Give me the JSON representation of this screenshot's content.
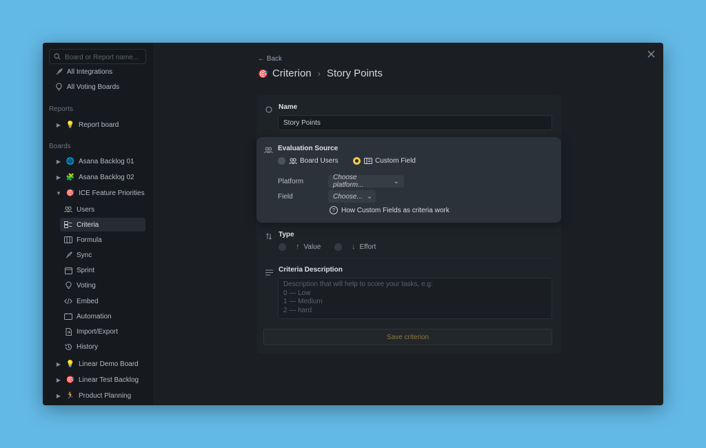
{
  "sidebar": {
    "search_placeholder": "Board or Report name...",
    "top_items": [
      {
        "label": "All Integrations",
        "icon": "rocket-icon"
      },
      {
        "label": "All Voting Boards",
        "icon": "lightbulb-icon"
      }
    ],
    "reports_heading": "Reports",
    "reports": [
      {
        "label": "Report board",
        "emoji": "💡"
      }
    ],
    "boards_heading": "Boards",
    "boards": [
      {
        "label": "Asana Backlog 01",
        "emoji": "🌐"
      },
      {
        "label": "Asana Backlog 02",
        "emoji": "🧩"
      },
      {
        "label": "ICE Feature Priorities",
        "emoji": "🎯"
      }
    ],
    "board_subitems": [
      {
        "label": "Users",
        "icon": "users-icon"
      },
      {
        "label": "Criteria",
        "icon": "criteria-icon"
      },
      {
        "label": "Formula",
        "icon": "formula-icon"
      },
      {
        "label": "Sync",
        "icon": "sync-icon"
      },
      {
        "label": "Sprint",
        "icon": "calendar-icon"
      },
      {
        "label": "Voting",
        "icon": "lightbulb-icon"
      },
      {
        "label": "Embed",
        "icon": "code-icon"
      },
      {
        "label": "Automation",
        "icon": "automation-icon"
      },
      {
        "label": "Import/Export",
        "icon": "import-export-icon"
      },
      {
        "label": "History",
        "icon": "history-icon"
      }
    ],
    "more_boards": [
      {
        "label": "Linear Demo Board",
        "emoji": "💡"
      },
      {
        "label": "Linear Test Backlog",
        "emoji": "🎯"
      },
      {
        "label": "Product Planning",
        "emoji": "🏃"
      }
    ]
  },
  "header": {
    "back_label": "← Back",
    "title_emoji": "🎯",
    "breadcrumb_parent": "Criterion",
    "breadcrumb_current": "Story Points"
  },
  "form": {
    "name_label": "Name",
    "name_value": "Story Points",
    "eval_label": "Evaluation Source",
    "source_board_users": "Board Users",
    "source_custom_field": "Custom Field",
    "platform_label": "Platform",
    "platform_placeholder": "Choose platform...",
    "field_label": "Field",
    "field_placeholder": "Choose...",
    "help_link": "How Custom Fields as criteria work",
    "type_label": "Type",
    "type_value": "Value",
    "type_effort": "Effort",
    "desc_label": "Criteria Description",
    "desc_placeholder": "Description that will help to score your tasks, e.g:\n0 — Low\n1 — Medium\n2 — hard",
    "save_label": "Save criterion"
  },
  "colors": {
    "accent_yellow": "#f3c84e",
    "value_green": "#4caf6a",
    "effort_red": "#e05a4f"
  }
}
